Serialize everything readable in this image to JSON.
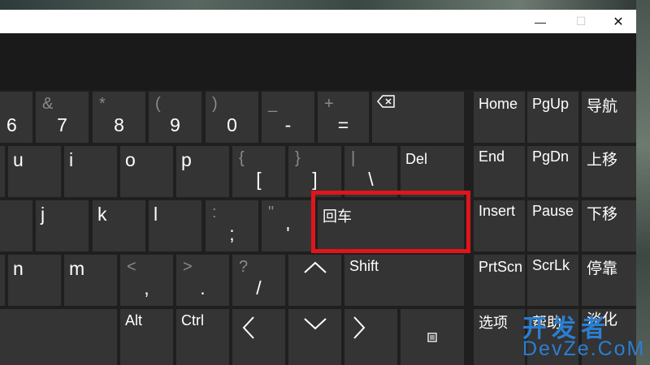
{
  "window": {
    "controls": {
      "minimize": "—",
      "maximize": "☐",
      "close": "✕"
    }
  },
  "keyboard": {
    "row_numbers": [
      {
        "alt": "",
        "main": "6"
      },
      {
        "alt": "&",
        "main": "7"
      },
      {
        "alt": "*",
        "main": "8"
      },
      {
        "alt": "(",
        "main": "9"
      },
      {
        "alt": ")",
        "main": "0"
      },
      {
        "alt": "_",
        "main": "-"
      },
      {
        "alt": "+",
        "main": "="
      }
    ],
    "backspace_icon": "backspace-icon",
    "row_top": [
      {
        "alt": "",
        "main": "u"
      },
      {
        "alt": "",
        "main": "i"
      },
      {
        "alt": "",
        "main": "o"
      },
      {
        "alt": "",
        "main": "p"
      },
      {
        "alt": "{",
        "main": "["
      },
      {
        "alt": "}",
        "main": "]"
      },
      {
        "alt": "|",
        "main": "\\"
      }
    ],
    "del": "Del",
    "row_home": [
      {
        "alt": "",
        "main": "j"
      },
      {
        "alt": "",
        "main": "k"
      },
      {
        "alt": "",
        "main": "l"
      },
      {
        "alt": ":",
        "main": ";"
      },
      {
        "alt": "\"",
        "main": "'"
      }
    ],
    "enter": "回车",
    "row_bottom": [
      {
        "alt": "",
        "main": "n"
      },
      {
        "alt": "",
        "main": "m"
      },
      {
        "alt": "<",
        "main": ","
      },
      {
        "alt": ">",
        "main": "."
      },
      {
        "alt": "?",
        "main": "/"
      }
    ],
    "shift": "Shift",
    "alt_key": "Alt",
    "ctrl_key": "Ctrl",
    "nav": [
      [
        "Home",
        "PgUp",
        "导航"
      ],
      [
        "End",
        "PgDn",
        "上移"
      ],
      [
        "Insert",
        "Pause",
        "下移"
      ],
      [
        "PrtScn",
        "ScrLk",
        "停靠"
      ],
      [
        "选项",
        "帮助",
        "淡化"
      ]
    ]
  },
  "watermark": {
    "line1": "开发者",
    "line2": "DevZe.CoM"
  }
}
